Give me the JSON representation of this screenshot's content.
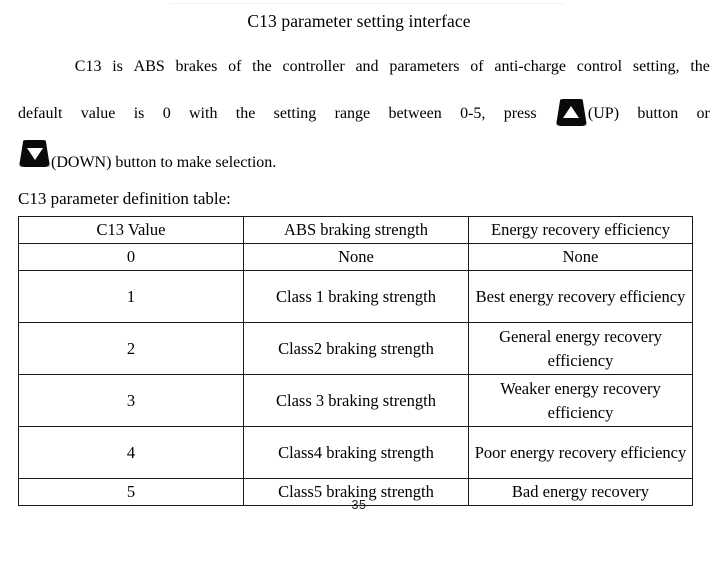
{
  "document": {
    "title": "C13 parameter setting interface",
    "page_footer": "- 35 -"
  },
  "paragraph": {
    "line1": {
      "words": [
        "C13",
        "is",
        "ABS",
        "brakes",
        "of",
        "the",
        "controller",
        "and",
        "parameters",
        "of",
        "anti-charge",
        "control",
        "setting,",
        "the"
      ]
    },
    "line2": {
      "words": [
        "default",
        "value",
        "is",
        "0",
        "with",
        "the",
        "setting",
        "range",
        "between",
        "0-5,",
        "press"
      ],
      "after_up_icon": "(UP)",
      "tail_words": [
        "button",
        "or"
      ]
    },
    "line3": {
      "after_down_icon": "(DOWN) button to make selection."
    },
    "up_button_icon": "up-triangle-button-icon",
    "down_button_icon": "down-triangle-button-icon"
  },
  "table_caption": "C13 parameter definition table:",
  "table": {
    "headers": [
      "C13 Value",
      "ABS braking strength",
      "Energy recovery efficiency"
    ],
    "rows": [
      {
        "value": "0",
        "braking": "None",
        "recovery": "None"
      },
      {
        "value": "1",
        "braking": "Class 1 braking strength",
        "recovery": "Best energy recovery efficiency"
      },
      {
        "value": "2",
        "braking": "Class2 braking strength",
        "recovery": "General energy recovery efficiency"
      },
      {
        "value": "3",
        "braking": "Class 3 braking strength",
        "recovery": "Weaker energy recovery efficiency"
      },
      {
        "value": "4",
        "braking": "Class4 braking strength",
        "recovery": "Poor energy recovery efficiency"
      },
      {
        "value": "5",
        "braking": "Class5 braking strength",
        "recovery": "Bad energy recovery"
      }
    ]
  },
  "colors": {
    "page_background": "#ffffff",
    "text": "#000000",
    "table_border": "#1a1a1a",
    "button_glyph": "#0a0a0a",
    "footer_text": "#222222"
  }
}
